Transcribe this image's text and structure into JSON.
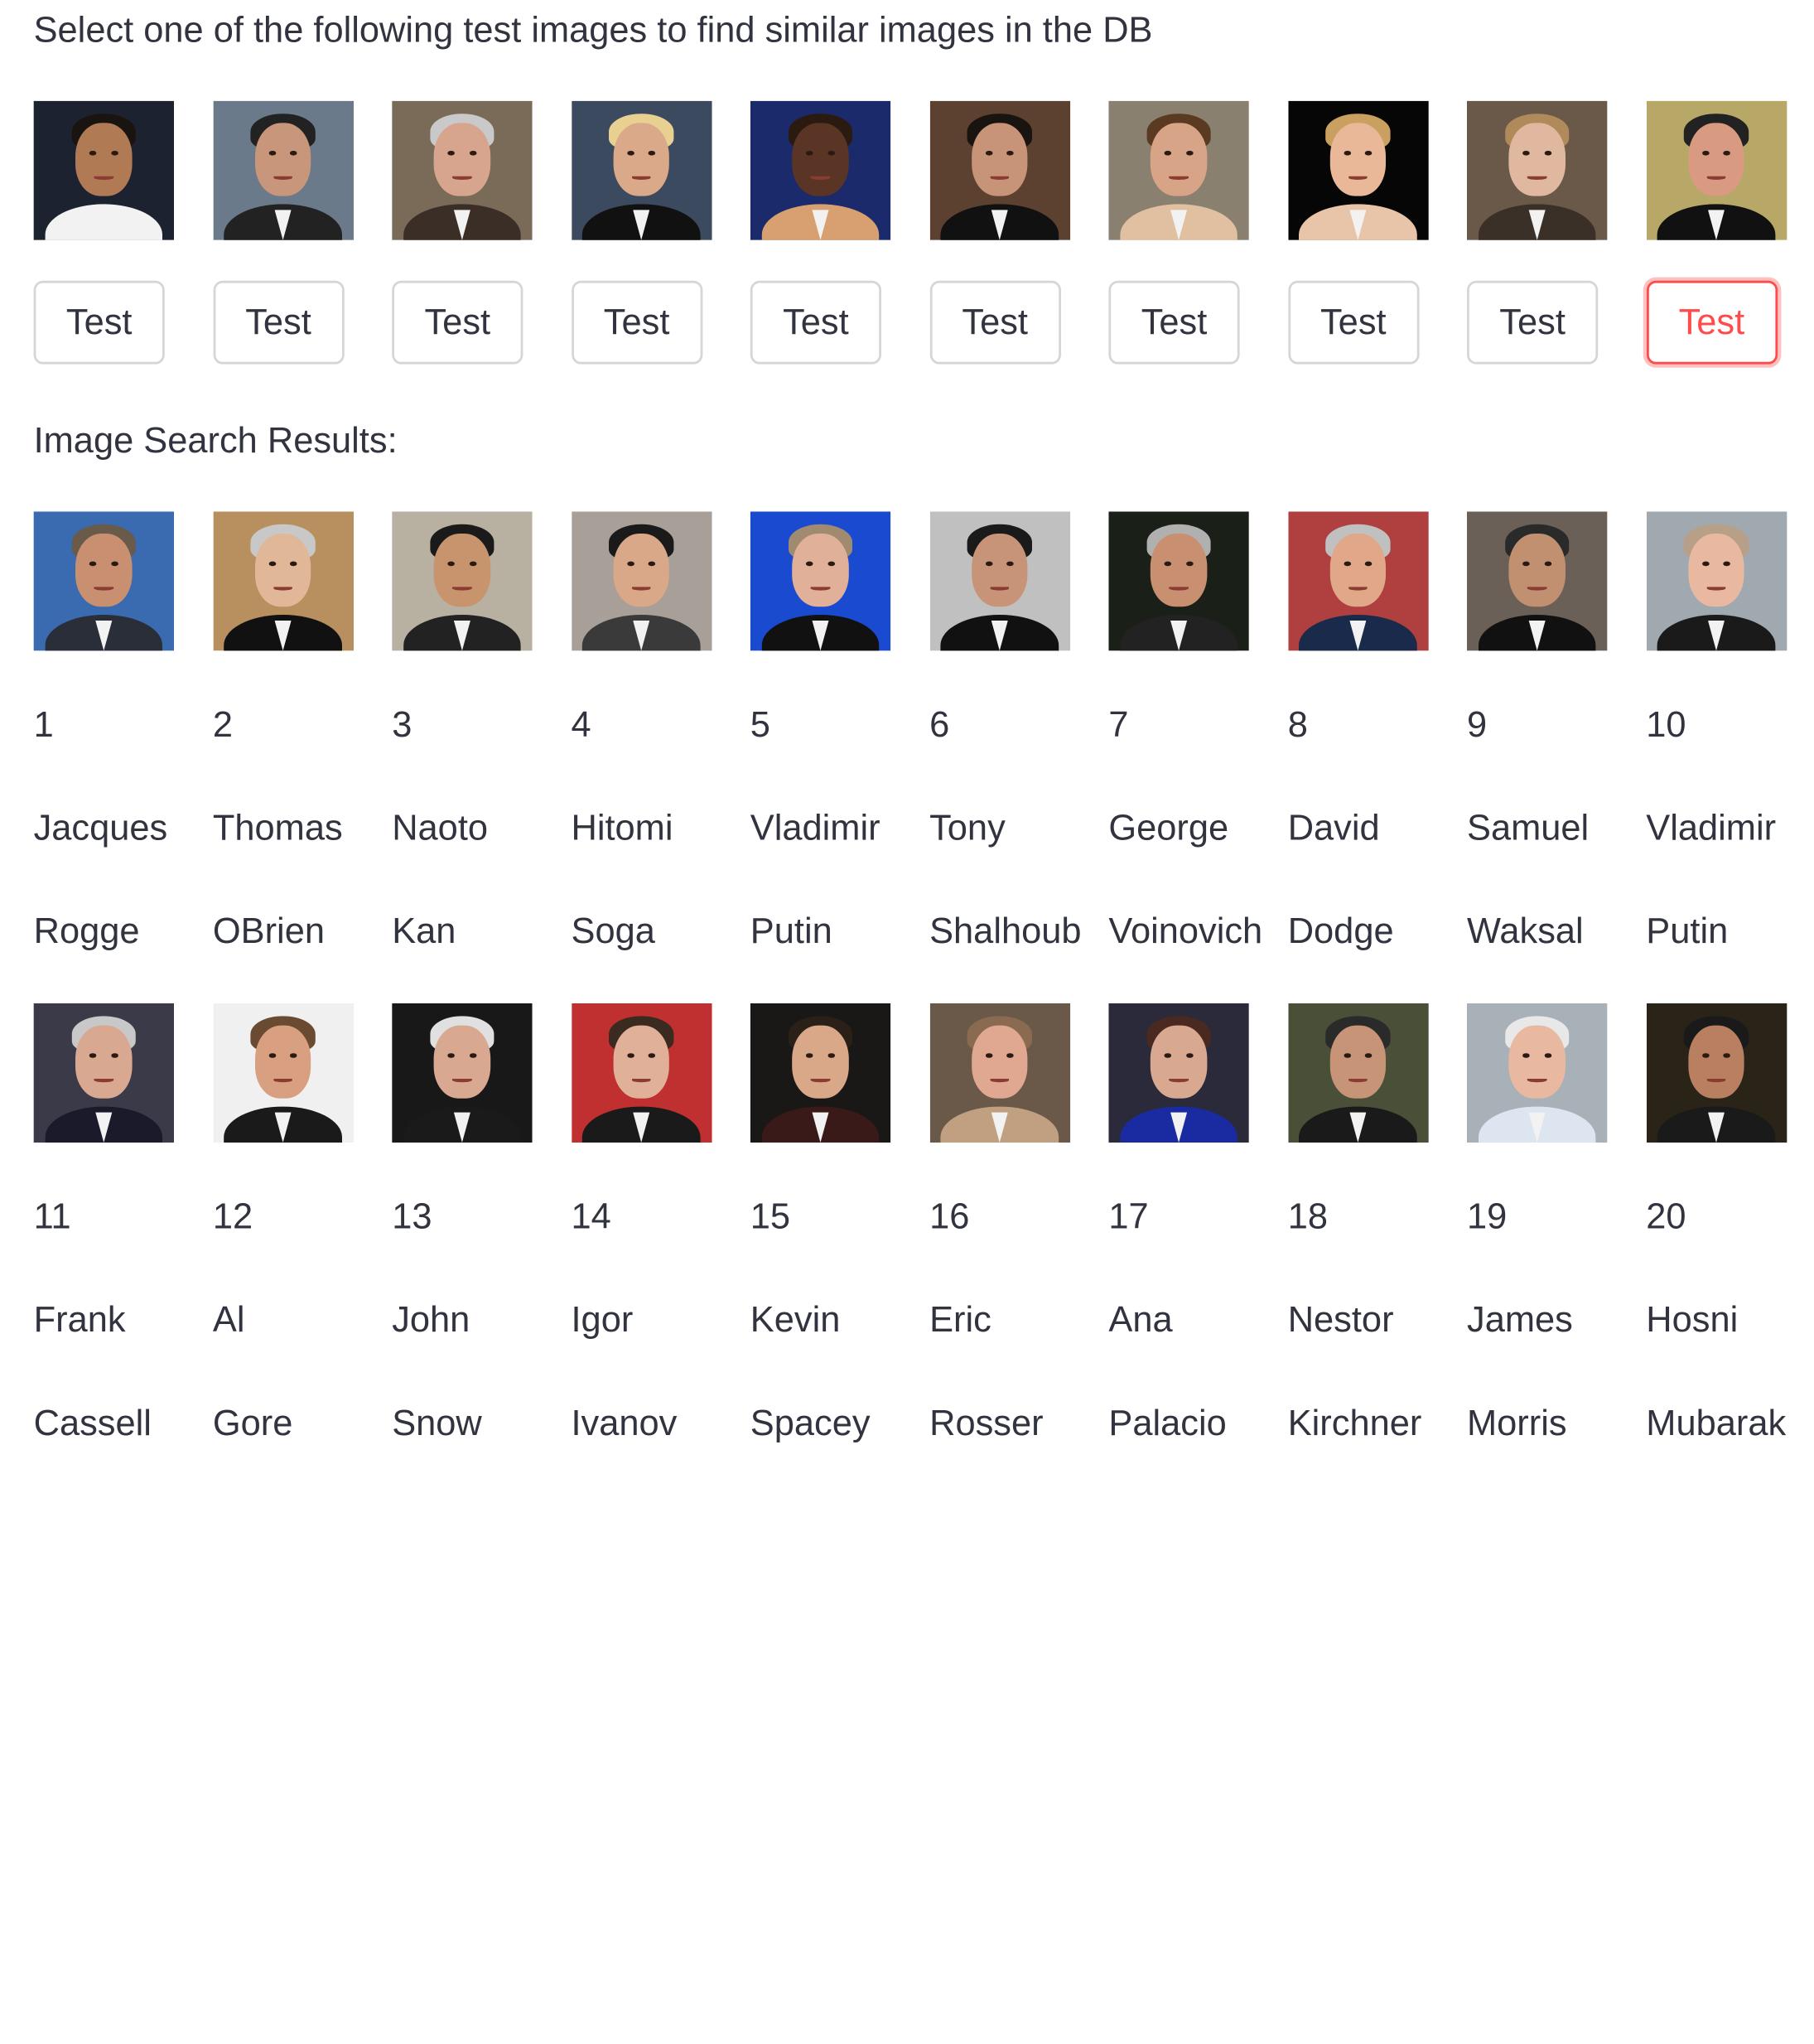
{
  "heading": "Select one of the following test images to find similar images in the DB",
  "test_button_label": "Test",
  "active_test_index": 9,
  "test_images": [
    {
      "bg": "#1c2230",
      "skin": "#b07a55",
      "hair": "#1a1410",
      "suit": "#f2f2f2"
    },
    {
      "bg": "#6b7a8a",
      "skin": "#c8967a",
      "hair": "#222222",
      "suit": "#222222"
    },
    {
      "bg": "#7a6a58",
      "skin": "#d7a58e",
      "hair": "#c9c9c9",
      "suit": "#3a2e26"
    },
    {
      "bg": "#3b4a5e",
      "skin": "#d9a98a",
      "hair": "#e8d090",
      "suit": "#111111"
    },
    {
      "bg": "#1a2a6a",
      "skin": "#5a3424",
      "hair": "#2a1a10",
      "suit": "#d8a070"
    },
    {
      "bg": "#5c4030",
      "skin": "#c89478",
      "hair": "#1a1410",
      "suit": "#111111"
    },
    {
      "bg": "#8a8070",
      "skin": "#d8a488",
      "hair": "#5a3a20",
      "suit": "#e0c0a0"
    },
    {
      "bg": "#060606",
      "skin": "#e8b898",
      "hair": "#caa060",
      "suit": "#e8c4a8"
    },
    {
      "bg": "#6a5848",
      "skin": "#e0b8a0",
      "hair": "#b08a5a",
      "suit": "#3a3028"
    },
    {
      "bg": "#b8a868",
      "skin": "#d89a80",
      "hair": "#222222",
      "suit": "#111111"
    }
  ],
  "results_title": "Image Search Results:",
  "results": [
    {
      "rank": "1",
      "first": "Jacques",
      "last": "Rogge",
      "bg": "#3a6ab0",
      "skin": "#c89070",
      "hair": "#6a5a4a",
      "suit": "#2a2e38"
    },
    {
      "rank": "2",
      "first": "Thomas",
      "last": "OBrien",
      "bg": "#b89060",
      "skin": "#e0b898",
      "hair": "#c8c8c8",
      "suit": "#111111"
    },
    {
      "rank": "3",
      "first": "Naoto",
      "last": "Kan",
      "bg": "#b8b0a0",
      "skin": "#c8946e",
      "hair": "#1a1a1a",
      "suit": "#222222"
    },
    {
      "rank": "4",
      "first": "Hitomi",
      "last": "Soga",
      "bg": "#a8a098",
      "skin": "#d8a888",
      "hair": "#1a1a1a",
      "suit": "#3a3a3a"
    },
    {
      "rank": "5",
      "first": "Vladimir",
      "last": "Putin",
      "bg": "#1a4ad0",
      "skin": "#e0b098",
      "hair": "#a08a70",
      "suit": "#111111"
    },
    {
      "rank": "6",
      "first": "Tony",
      "last": "Shalhoub",
      "bg": "#c0c0c0",
      "skin": "#c89478",
      "hair": "#1a1a1a",
      "suit": "#111111"
    },
    {
      "rank": "7",
      "first": "George",
      "last": "Voinovich",
      "bg": "#1a2018",
      "skin": "#c89070",
      "hair": "#b0b0b0",
      "suit": "#222222"
    },
    {
      "rank": "8",
      "first": "David",
      "last": "Dodge",
      "bg": "#b04040",
      "skin": "#e0a888",
      "hair": "#c0c0c0",
      "suit": "#1a2a4a"
    },
    {
      "rank": "9",
      "first": "Samuel",
      "last": "Waksal",
      "bg": "#6a6058",
      "skin": "#c09070",
      "hair": "#2a2a2a",
      "suit": "#111111"
    },
    {
      "rank": "10",
      "first": "Vladimir",
      "last": "Putin",
      "bg": "#a0a8b0",
      "skin": "#e8b8a0",
      "hair": "#b8a088",
      "suit": "#1a1a1a"
    },
    {
      "rank": "11",
      "first": "Frank",
      "last": "Cassell",
      "bg": "#3a3a48",
      "skin": "#d8a890",
      "hair": "#c8c8c8",
      "suit": "#1a1a2a"
    },
    {
      "rank": "12",
      "first": "Al",
      "last": "Gore",
      "bg": "#f0f0f0",
      "skin": "#d8a080",
      "hair": "#6a4a30",
      "suit": "#1a1a1a"
    },
    {
      "rank": "13",
      "first": "John",
      "last": "Snow",
      "bg": "#181818",
      "skin": "#d8a890",
      "hair": "#e0e0e0",
      "suit": "#1a1a1a"
    },
    {
      "rank": "14",
      "first": "Igor",
      "last": "Ivanov",
      "bg": "#c03030",
      "skin": "#e0b098",
      "hair": "#3a2a20",
      "suit": "#1a1a1a"
    },
    {
      "rank": "15",
      "first": "Kevin",
      "last": "Spacey",
      "bg": "#1a1816",
      "skin": "#d8a888",
      "hair": "#2a2018",
      "suit": "#3a1a18"
    },
    {
      "rank": "16",
      "first": "Eric",
      "last": "Rosser",
      "bg": "#6a5848",
      "skin": "#e0a890",
      "hair": "#8a6a50",
      "suit": "#c0a080"
    },
    {
      "rank": "17",
      "first": "Ana",
      "last": "Palacio",
      "bg": "#2a2a3a",
      "skin": "#d8a890",
      "hair": "#4a2a20",
      "suit": "#1a2aa0"
    },
    {
      "rank": "18",
      "first": "Nestor",
      "last": "Kirchner",
      "bg": "#4a5038",
      "skin": "#c89478",
      "hair": "#2a2a2a",
      "suit": "#1a1a1a"
    },
    {
      "rank": "19",
      "first": "James",
      "last": "Morris",
      "bg": "#a8b0b8",
      "skin": "#e8b8a0",
      "hair": "#e8e8e8",
      "suit": "#dde6f0"
    },
    {
      "rank": "20",
      "first": "Hosni",
      "last": "Mubarak",
      "bg": "#2a2418",
      "skin": "#b88060",
      "hair": "#1a1a1a",
      "suit": "#1a1a1a"
    }
  ]
}
